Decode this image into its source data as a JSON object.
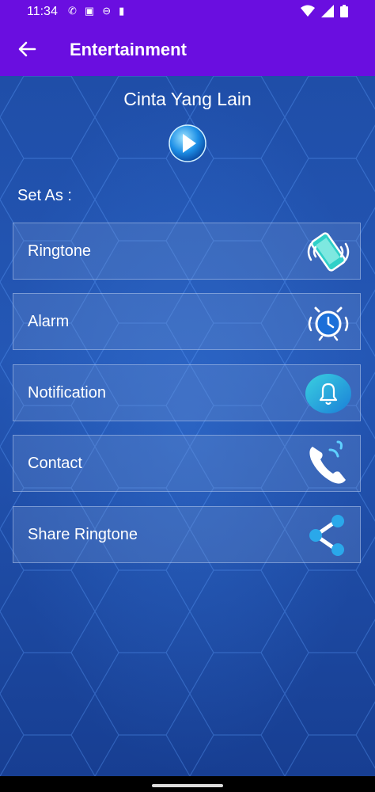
{
  "status": {
    "time": "11:34"
  },
  "appbar": {
    "title": "Entertainment"
  },
  "song": {
    "title": "Cinta Yang Lain"
  },
  "set_as_label": "Set As :",
  "options": [
    {
      "label": "Ringtone",
      "icon": "vibrating-phone-icon"
    },
    {
      "label": "Alarm",
      "icon": "alarm-clock-icon"
    },
    {
      "label": "Notification",
      "icon": "bell-icon"
    },
    {
      "label": "Contact",
      "icon": "phone-call-icon"
    },
    {
      "label": "Share Ringtone",
      "icon": "share-icon"
    }
  ],
  "colors": {
    "appbar": "#6a0ee0",
    "background": "#2457b5",
    "icon_accent": "#3ad0e0"
  }
}
